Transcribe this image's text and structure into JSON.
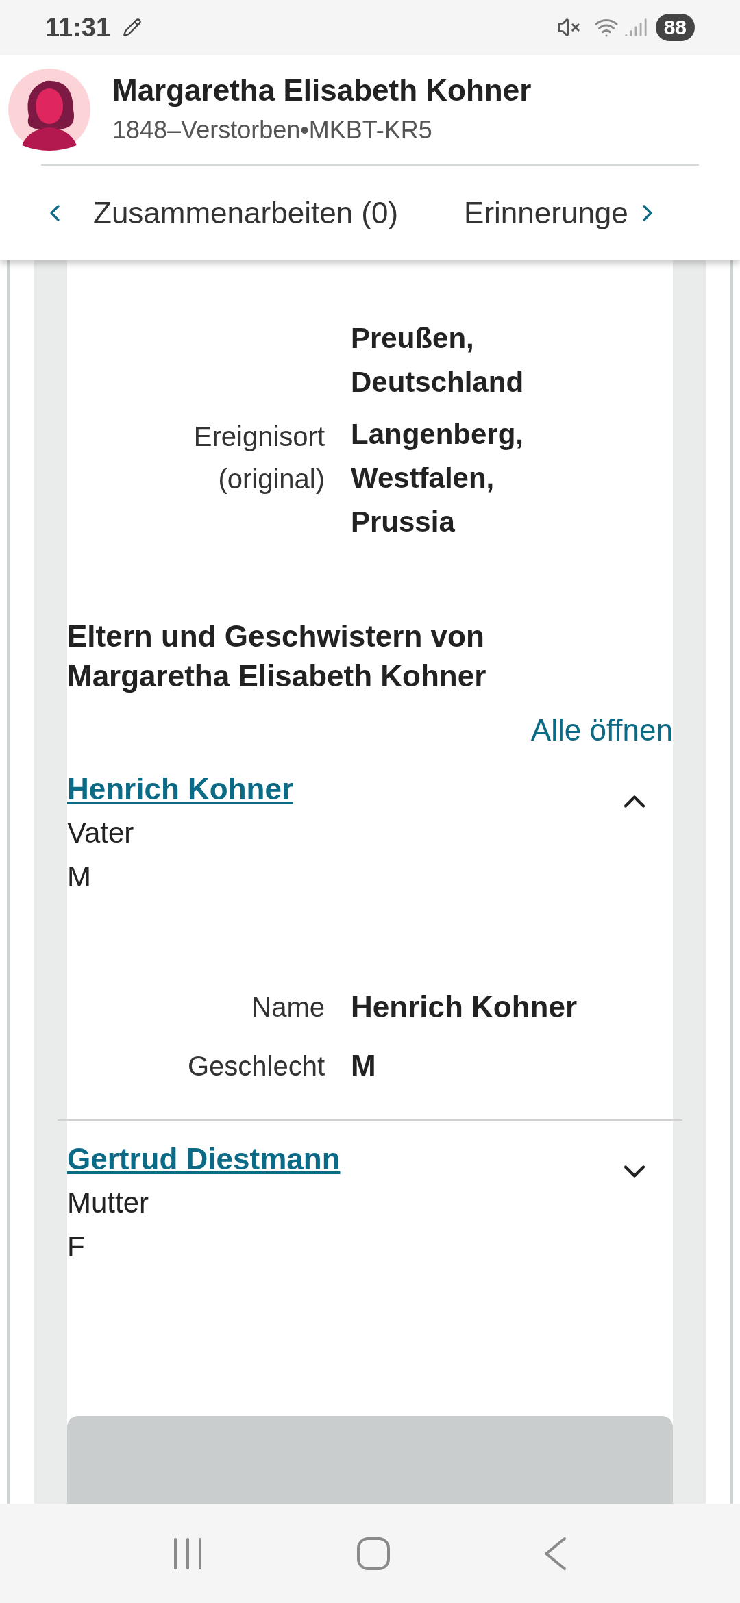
{
  "status_bar": {
    "time": "11:31",
    "battery": "88"
  },
  "header": {
    "name": "Margaretha Elisabeth Kohner",
    "subtitle": "1848–Verstorben•MKBT-KR5"
  },
  "tabs": [
    {
      "label": "Zusammenarbeiten (0)",
      "selected": false
    },
    {
      "label": "Erinnerunge",
      "selected": false
    }
  ],
  "facts": [
    {
      "value": "Preußen, Deutschland"
    },
    {
      "label": "Ereignisort (original)",
      "value": "Langenberg, Westfalen, Prussia"
    }
  ],
  "family_section": {
    "title": "Eltern und Geschwistern von Margaretha Elisabeth Kohner",
    "expand_all": "Alle öffnen",
    "people": [
      {
        "name": "Henrich Kohner",
        "relation": "Vater",
        "sex": "M",
        "expanded": true,
        "details": [
          {
            "label": "Name",
            "value": "Henrich Kohner"
          },
          {
            "label": "Geschlecht",
            "value": "M"
          }
        ]
      },
      {
        "name": "Gertrud Diestmann",
        "relation": "Mutter",
        "sex": "F",
        "expanded": false
      }
    ]
  }
}
